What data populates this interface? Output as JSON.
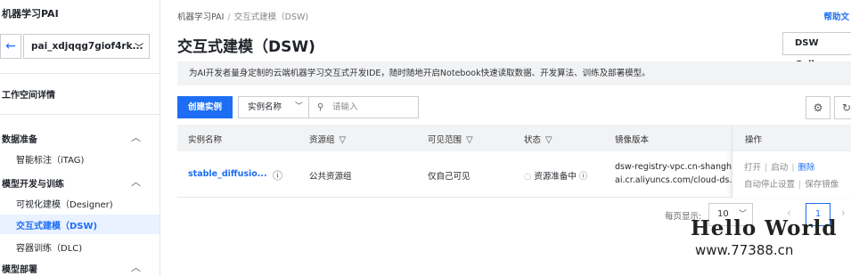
{
  "sidebar": {
    "app_title": "机器学习PAI",
    "workspace": "pai_xdjqqg7giof4rk...",
    "workspace_details": "工作空间详情",
    "groups": [
      {
        "label": "数据准备",
        "items": [
          "智能标注（iTAG)"
        ]
      },
      {
        "label": "模型开发与训练",
        "items": [
          "可视化建模（Designer)",
          "交互式建模（DSW)",
          "容器训练（DLC)"
        ]
      },
      {
        "label": "模型部署",
        "items": []
      }
    ],
    "active_item": "交互式建模（DSW)"
  },
  "breadcrumb": {
    "root": "机器学习PAI",
    "sep": "/",
    "current": "交互式建模（DSW)"
  },
  "help_label": "帮助文",
  "page_title": "交互式建模（DSW)",
  "gallery_label": "DSW Gallery",
  "notice": "为AI开发者量身定制的云端机器学习交互式开发IDE，随时随地开启Notebook快速读取数据、开发算法、训练及部署模型。",
  "toolbar": {
    "create_label": "创建实例",
    "filter_field": "实例名称",
    "search_placeholder": "请输入"
  },
  "table": {
    "columns": [
      "实例名称",
      "资源组",
      "可见范围",
      "状态",
      "镜像版本",
      "操作"
    ],
    "rows": [
      {
        "name": "stable_diffusio...",
        "resource_group": "公共资源组",
        "visibility": "仅自己可见",
        "status": "资源准备中",
        "image_line1": "dsw-registry-vpc.cn-shangh",
        "image_line2": "ai.cr.aliyuncs.com/cloud-ds...",
        "ops_row1": [
          "打开",
          "启动",
          "删除"
        ],
        "ops_row2": [
          "自动停止设置",
          "保存镜像"
        ]
      }
    ]
  },
  "pager": {
    "label": "每页显示:",
    "page_size": "10",
    "current_page": "1"
  },
  "watermark": {
    "line1": "Hello World",
    "line2": "www.77388.cn"
  },
  "colors": {
    "accent": "#1d6ef5",
    "header_bg": "#f2f3f5",
    "active_bg": "#eaf1ff"
  }
}
